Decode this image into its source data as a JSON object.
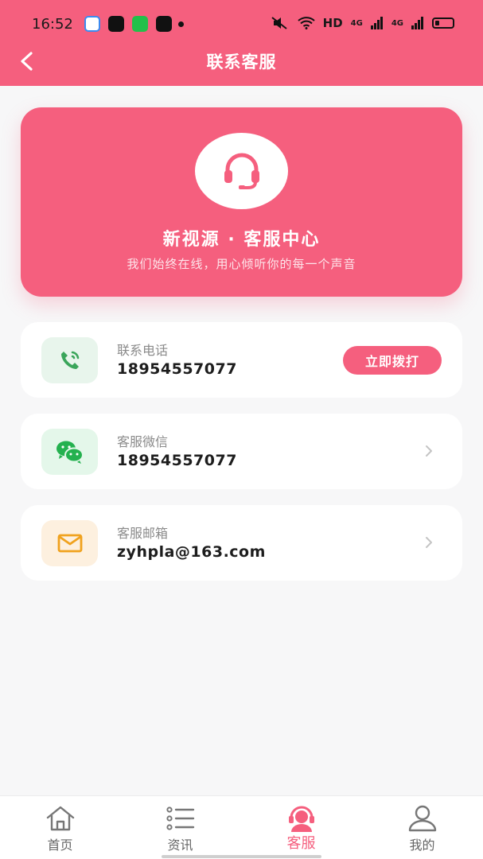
{
  "status_bar": {
    "time": "16:52",
    "network_label": "HD",
    "signal1": "4G",
    "signal2": "4G"
  },
  "header": {
    "title": "联系客服",
    "back_icon": "chevron-left-icon",
    "background": "#f55f7e"
  },
  "hero": {
    "icon": "headset-icon",
    "title": "新视源 · 客服中心",
    "subtitle": "我们始终在线，用心倾听你的每一个声音"
  },
  "contacts": [
    {
      "icon": "phone-icon",
      "label": "联系电话",
      "value": "18954557077",
      "action_label": "立即拨打",
      "icon_bg": "#e8f5ec",
      "icon_color": "#3aa55a"
    },
    {
      "icon": "wechat-icon",
      "label": "客服微信",
      "value": "18954557077",
      "icon_bg": "#e4f7ea",
      "icon_color": "#24b14f"
    },
    {
      "icon": "mail-icon",
      "label": "客服邮箱",
      "value": "zyhpla@163.com",
      "icon_bg": "#fdf0df",
      "icon_color": "#f0a21e"
    }
  ],
  "tabbar": {
    "items": [
      {
        "label": "首页",
        "icon": "home-icon",
        "active": false
      },
      {
        "label": "资讯",
        "icon": "list-icon",
        "active": false
      },
      {
        "label": "客服",
        "icon": "service-icon",
        "active": true
      },
      {
        "label": "我的",
        "icon": "user-icon",
        "active": false
      }
    ],
    "active_color": "#f55f7e"
  }
}
